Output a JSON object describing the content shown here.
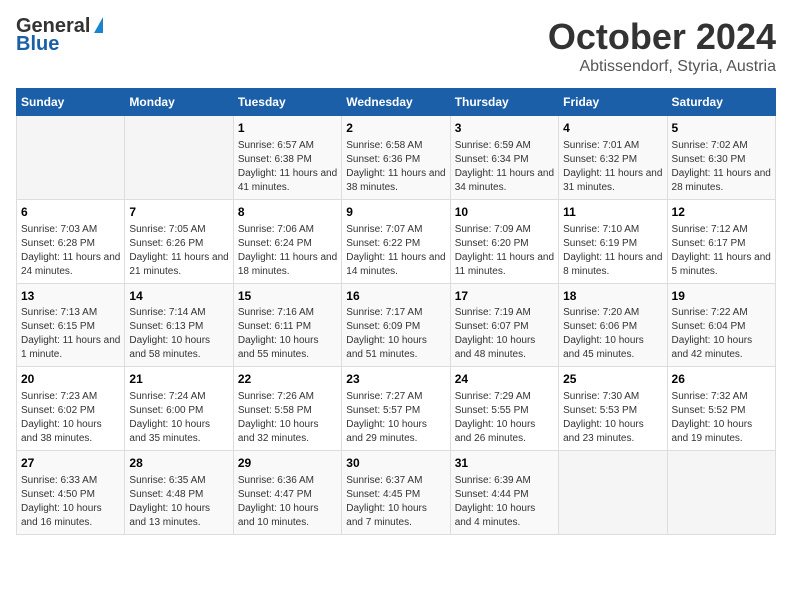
{
  "logo": {
    "general": "General",
    "blue": "Blue"
  },
  "title": "October 2024",
  "location": "Abtissendorf, Styria, Austria",
  "days_of_week": [
    "Sunday",
    "Monday",
    "Tuesday",
    "Wednesday",
    "Thursday",
    "Friday",
    "Saturday"
  ],
  "weeks": [
    [
      {
        "day": "",
        "info": ""
      },
      {
        "day": "",
        "info": ""
      },
      {
        "day": "1",
        "info": "Sunrise: 6:57 AM\nSunset: 6:38 PM\nDaylight: 11 hours and 41 minutes."
      },
      {
        "day": "2",
        "info": "Sunrise: 6:58 AM\nSunset: 6:36 PM\nDaylight: 11 hours and 38 minutes."
      },
      {
        "day": "3",
        "info": "Sunrise: 6:59 AM\nSunset: 6:34 PM\nDaylight: 11 hours and 34 minutes."
      },
      {
        "day": "4",
        "info": "Sunrise: 7:01 AM\nSunset: 6:32 PM\nDaylight: 11 hours and 31 minutes."
      },
      {
        "day": "5",
        "info": "Sunrise: 7:02 AM\nSunset: 6:30 PM\nDaylight: 11 hours and 28 minutes."
      }
    ],
    [
      {
        "day": "6",
        "info": "Sunrise: 7:03 AM\nSunset: 6:28 PM\nDaylight: 11 hours and 24 minutes."
      },
      {
        "day": "7",
        "info": "Sunrise: 7:05 AM\nSunset: 6:26 PM\nDaylight: 11 hours and 21 minutes."
      },
      {
        "day": "8",
        "info": "Sunrise: 7:06 AM\nSunset: 6:24 PM\nDaylight: 11 hours and 18 minutes."
      },
      {
        "day": "9",
        "info": "Sunrise: 7:07 AM\nSunset: 6:22 PM\nDaylight: 11 hours and 14 minutes."
      },
      {
        "day": "10",
        "info": "Sunrise: 7:09 AM\nSunset: 6:20 PM\nDaylight: 11 hours and 11 minutes."
      },
      {
        "day": "11",
        "info": "Sunrise: 7:10 AM\nSunset: 6:19 PM\nDaylight: 11 hours and 8 minutes."
      },
      {
        "day": "12",
        "info": "Sunrise: 7:12 AM\nSunset: 6:17 PM\nDaylight: 11 hours and 5 minutes."
      }
    ],
    [
      {
        "day": "13",
        "info": "Sunrise: 7:13 AM\nSunset: 6:15 PM\nDaylight: 11 hours and 1 minute."
      },
      {
        "day": "14",
        "info": "Sunrise: 7:14 AM\nSunset: 6:13 PM\nDaylight: 10 hours and 58 minutes."
      },
      {
        "day": "15",
        "info": "Sunrise: 7:16 AM\nSunset: 6:11 PM\nDaylight: 10 hours and 55 minutes."
      },
      {
        "day": "16",
        "info": "Sunrise: 7:17 AM\nSunset: 6:09 PM\nDaylight: 10 hours and 51 minutes."
      },
      {
        "day": "17",
        "info": "Sunrise: 7:19 AM\nSunset: 6:07 PM\nDaylight: 10 hours and 48 minutes."
      },
      {
        "day": "18",
        "info": "Sunrise: 7:20 AM\nSunset: 6:06 PM\nDaylight: 10 hours and 45 minutes."
      },
      {
        "day": "19",
        "info": "Sunrise: 7:22 AM\nSunset: 6:04 PM\nDaylight: 10 hours and 42 minutes."
      }
    ],
    [
      {
        "day": "20",
        "info": "Sunrise: 7:23 AM\nSunset: 6:02 PM\nDaylight: 10 hours and 38 minutes."
      },
      {
        "day": "21",
        "info": "Sunrise: 7:24 AM\nSunset: 6:00 PM\nDaylight: 10 hours and 35 minutes."
      },
      {
        "day": "22",
        "info": "Sunrise: 7:26 AM\nSunset: 5:58 PM\nDaylight: 10 hours and 32 minutes."
      },
      {
        "day": "23",
        "info": "Sunrise: 7:27 AM\nSunset: 5:57 PM\nDaylight: 10 hours and 29 minutes."
      },
      {
        "day": "24",
        "info": "Sunrise: 7:29 AM\nSunset: 5:55 PM\nDaylight: 10 hours and 26 minutes."
      },
      {
        "day": "25",
        "info": "Sunrise: 7:30 AM\nSunset: 5:53 PM\nDaylight: 10 hours and 23 minutes."
      },
      {
        "day": "26",
        "info": "Sunrise: 7:32 AM\nSunset: 5:52 PM\nDaylight: 10 hours and 19 minutes."
      }
    ],
    [
      {
        "day": "27",
        "info": "Sunrise: 6:33 AM\nSunset: 4:50 PM\nDaylight: 10 hours and 16 minutes."
      },
      {
        "day": "28",
        "info": "Sunrise: 6:35 AM\nSunset: 4:48 PM\nDaylight: 10 hours and 13 minutes."
      },
      {
        "day": "29",
        "info": "Sunrise: 6:36 AM\nSunset: 4:47 PM\nDaylight: 10 hours and 10 minutes."
      },
      {
        "day": "30",
        "info": "Sunrise: 6:37 AM\nSunset: 4:45 PM\nDaylight: 10 hours and 7 minutes."
      },
      {
        "day": "31",
        "info": "Sunrise: 6:39 AM\nSunset: 4:44 PM\nDaylight: 10 hours and 4 minutes."
      },
      {
        "day": "",
        "info": ""
      },
      {
        "day": "",
        "info": ""
      }
    ]
  ]
}
